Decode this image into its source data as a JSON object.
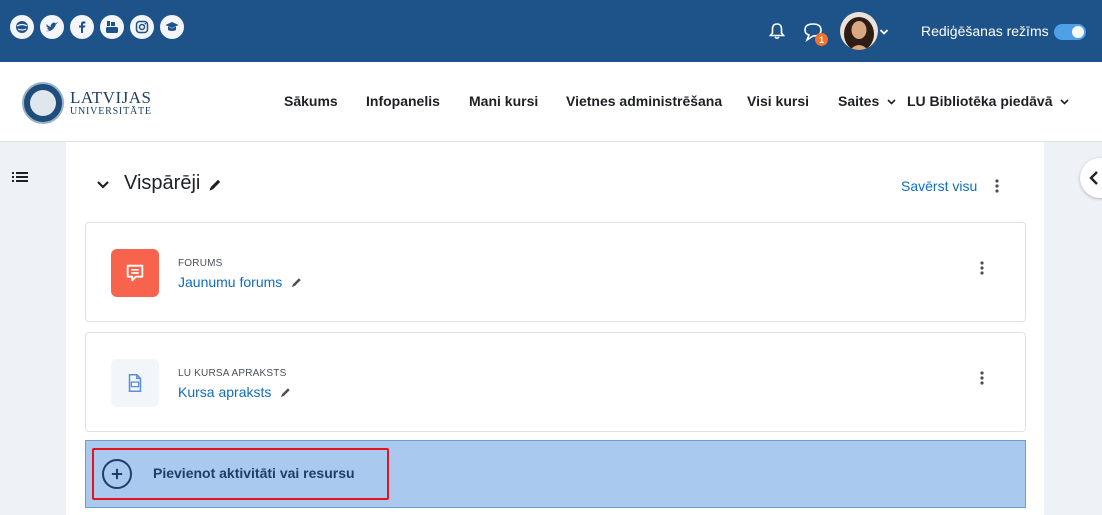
{
  "topbar": {
    "social_icons": [
      "globe-icon",
      "twitter-icon",
      "facebook-icon",
      "youtube-icon",
      "instagram-icon",
      "graduation-cap-icon"
    ],
    "notifications_icon": "bell-icon",
    "messages_icon": "chat-icon",
    "messages_badge": "1",
    "edit_mode_label": "Rediģēšanas režīms",
    "edit_mode_on": true,
    "bar_color": "#1e5389"
  },
  "navbar": {
    "logo_line1": "LATVIJAS",
    "logo_line2": "UNIVERSITĀTE",
    "items": [
      {
        "label": "Sākums"
      },
      {
        "label": "Infopanelis"
      },
      {
        "label": "Mani kursi"
      },
      {
        "label": "Vietnes administrēšana"
      },
      {
        "label": "Visi kursi"
      },
      {
        "label": "Saites"
      },
      {
        "label": "LU Bibliotēka piedāvā"
      }
    ]
  },
  "section": {
    "title": "Vispārēji",
    "collapse_all": "Savērst visu"
  },
  "activities": [
    {
      "type": "FORUMS",
      "name": "Jaunumu forums",
      "icon": "forum-icon",
      "icon_bg": "#f7634d"
    },
    {
      "type": "LU KURSA APRAKSTS",
      "name": "Kursa apraksts",
      "icon": "document-icon",
      "icon_bg": "#f2f5fa"
    }
  ],
  "add_activity": {
    "label": "Pievienot aktivitāti vai resursu",
    "highlight_color": "#e8111d"
  }
}
